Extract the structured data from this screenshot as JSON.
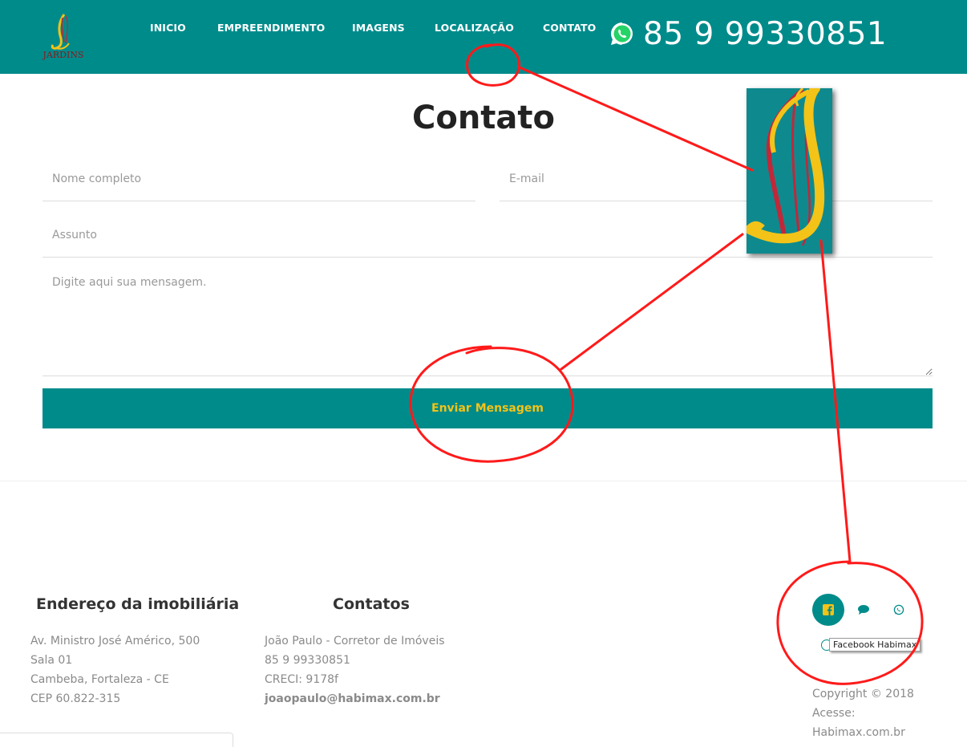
{
  "header": {
    "logo_text": "JARDINS",
    "nav": [
      {
        "label": "INICIO"
      },
      {
        "label": "EMPREENDIMENTO"
      },
      {
        "label": "IMAGENS"
      },
      {
        "label": "LOCALIZAÇÃO"
      },
      {
        "label": "CONTATO"
      }
    ],
    "phone": "85 9 99330851",
    "phone_icon": "whatsapp-icon"
  },
  "contact": {
    "title": "Contato",
    "name_placeholder": "Nome completo",
    "email_placeholder": "E-mail",
    "subject_placeholder": "Assunto",
    "message_placeholder": "Digite aqui sua mensagem.",
    "submit_label": "Enviar Mensagem"
  },
  "footer": {
    "address": {
      "heading": "Endereço da imobiliária",
      "lines": [
        "Av. Ministro José Américo, 500",
        "Sala 01",
        "Cambeba, Fortaleza - CE",
        "CEP 60.822-315"
      ]
    },
    "contacts": {
      "heading": "Contatos",
      "lines": [
        "João Paulo - Corretor de Imóveis",
        "85 9 99330851",
        "CRECI: 9178f"
      ],
      "email": "joaopaulo@habimax.com.br"
    },
    "social": {
      "icons": [
        "facebook-icon",
        "chat-icon",
        "whatsapp-icon"
      ],
      "tooltip": "Facebook Habimax"
    },
    "copyright": [
      "Copyright © 2018",
      "Acesse:",
      "Habimax.com.br"
    ]
  },
  "colors": {
    "primary": "#008b8b",
    "accent": "#f3c318",
    "annotation": "#ff0000"
  }
}
